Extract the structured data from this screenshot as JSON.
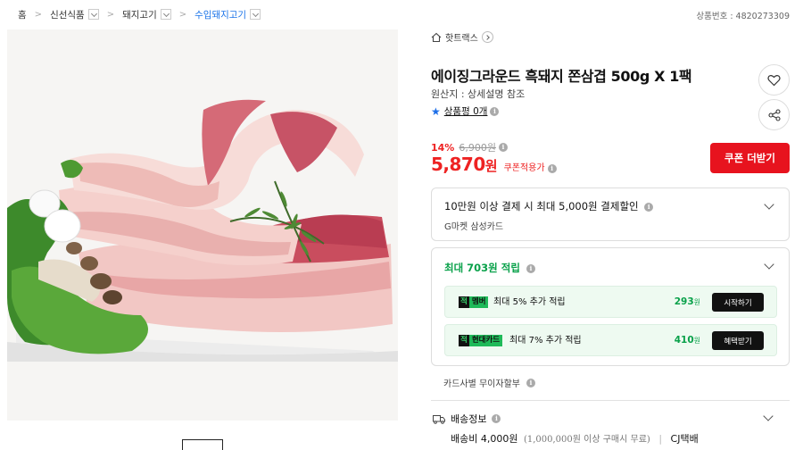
{
  "breadcrumb": [
    {
      "label": "홈"
    },
    {
      "label": "신선식품"
    },
    {
      "label": "돼지고기"
    },
    {
      "label": "수입돼지고기"
    }
  ],
  "product_no": "상품번호 : 4820273309",
  "store": {
    "name": "핫트랙스"
  },
  "product": {
    "title": "에이징그라운드 흑돼지 쫀삼겹 500g X 1팩",
    "origin": "원산지 : 상세설명 참조",
    "review_label": "상품평 0개"
  },
  "price": {
    "discount_rate": "14%",
    "original": "6,900원",
    "final_value": "5,870",
    "final_unit": "원",
    "coupon_applied": "쿠폰적용가",
    "coupon_button": "쿠폰 더받기"
  },
  "benefit": {
    "title": "10만원 이상 결제 시 최대 5,000원 결제할인",
    "subtitle": "G마켓 삼성카드"
  },
  "points": {
    "title": "최대 703원 적립",
    "rows": [
      {
        "badge_mark": "적",
        "badge_label": "멤버",
        "desc": "최대 5% 추가 적립",
        "amount": "293",
        "unit": "원",
        "button": "시작하기"
      },
      {
        "badge_mark": "적",
        "badge_label": "현대카드",
        "desc": "최대 7% 추가 적립",
        "amount": "410",
        "unit": "원",
        "button": "혜택받기"
      }
    ]
  },
  "installment": "카드사별 무이자할부",
  "shipping": {
    "title": "배송정보",
    "fee": "배송비 4,000원",
    "condition": "(1,000,000원 이상 구매시 무료)",
    "carrier": "CJ택배"
  },
  "colors": {
    "accent_red": "#e7131e",
    "point_green": "#09a14a",
    "link_blue": "#1a73e8"
  }
}
